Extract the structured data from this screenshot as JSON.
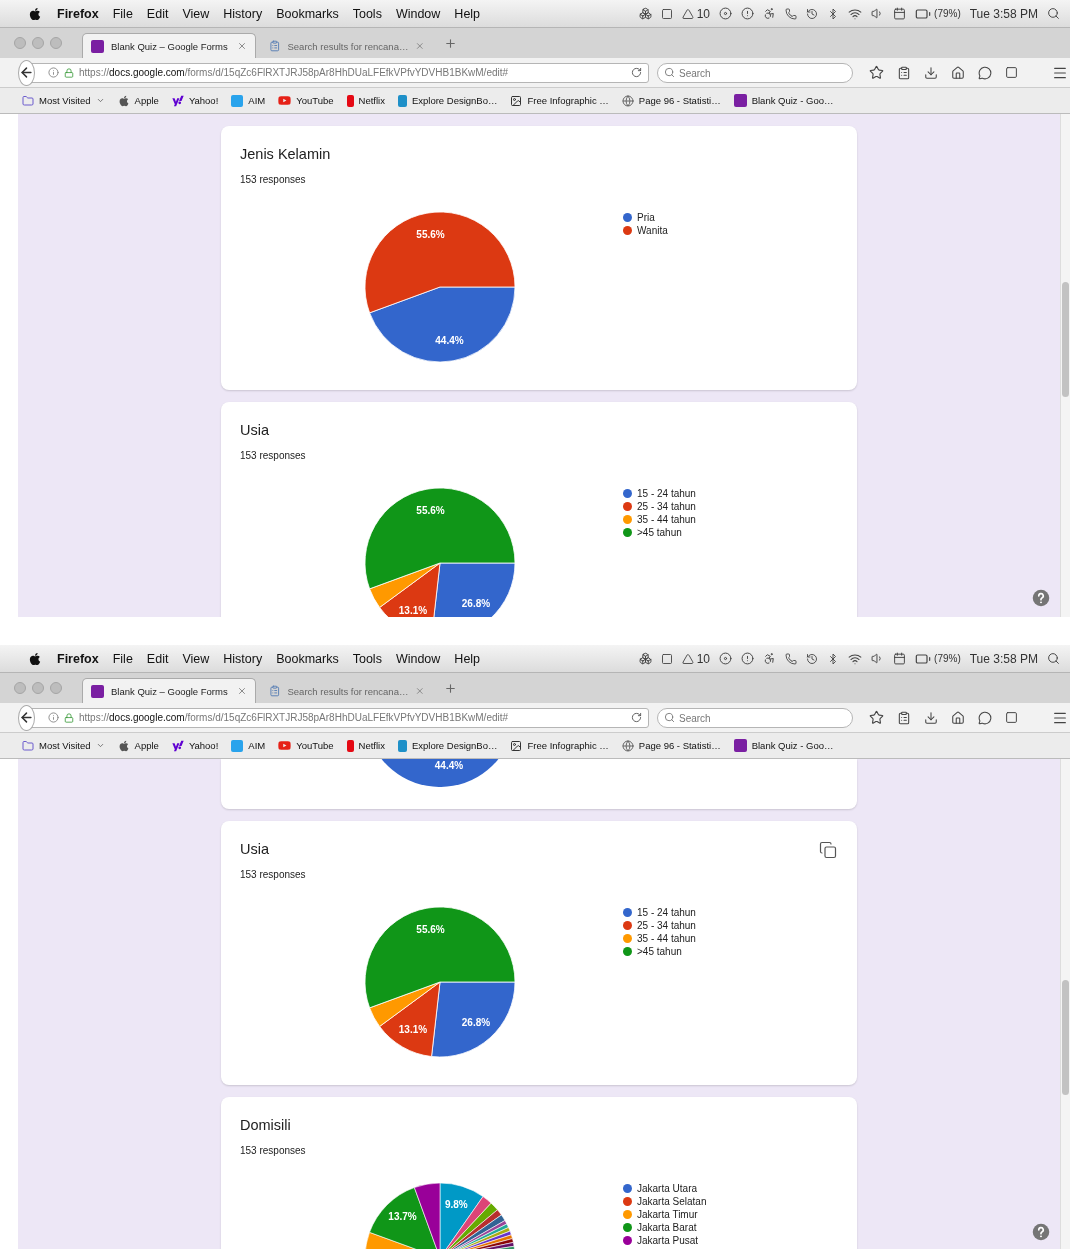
{
  "screens": [
    {
      "menubar": {
        "app": "Firefox",
        "menus": [
          "File",
          "Edit",
          "View",
          "History",
          "Bookmarks",
          "Tools",
          "Window",
          "Help"
        ],
        "status_count": "10",
        "battery": "(79%)",
        "clock": "Tue 3:58 PM"
      },
      "tabs": [
        {
          "label": "Blank Quiz – Google Forms",
          "selected": true
        },
        {
          "label": "Search results for rencana…",
          "selected": false
        }
      ],
      "url": "https://**docs.google.com**/forms/d/15qZc6FlRXTJRJ58pAr8HhDUaLFEfkVPfvYDVHB1BKwM/edit#",
      "search": {
        "placeholder": "Search"
      },
      "bookmarks": [
        "Most Visited",
        "Apple",
        "Yahoo!",
        "AIM",
        "YouTube",
        "Netflix",
        "Explore DesignBo…",
        "Free Infographic …",
        "Page 96 - Statisti…",
        "Blank Quiz - Goo…"
      ],
      "cards": [
        {
          "kind": "chart",
          "title": "Jenis Kelamin",
          "responses": "153 responses",
          "copy_icon": false,
          "chart_data": {
            "type": "pie",
            "categories": [
              "Pria",
              "Wanita"
            ],
            "values": [
              44.4,
              55.6
            ],
            "colors": [
              "#3366cc",
              "#dc3912"
            ],
            "value_labels": [
              "44.4%",
              "55.6%"
            ]
          }
        },
        {
          "kind": "chart",
          "title": "Usia",
          "responses": "153 responses",
          "copy_icon": false,
          "chart_data": {
            "type": "pie",
            "categories": [
              "15 - 24 tahun",
              "25 - 34 tahun",
              "35 - 44 tahun",
              ">45 tahun"
            ],
            "values": [
              26.8,
              13.1,
              4.5,
              55.6
            ],
            "colors": [
              "#3366cc",
              "#dc3912",
              "#ff9900",
              "#109618"
            ],
            "value_labels": [
              "26.8%",
              "13.1%",
              null,
              "55.6%"
            ]
          }
        }
      ]
    },
    {
      "menubar": {
        "app": "Firefox",
        "menus": [
          "File",
          "Edit",
          "View",
          "History",
          "Bookmarks",
          "Tools",
          "Window",
          "Help"
        ],
        "status_count": "10",
        "battery": "(79%)",
        "clock": "Tue 3:58 PM"
      },
      "tabs": [
        {
          "label": "Blank Quiz – Google Forms",
          "selected": true
        },
        {
          "label": "Search results for rencana…",
          "selected": false
        }
      ],
      "url": "https://**docs.google.com**/forms/d/15qZc6FlRXTJRJ58pAr8HhDUaLFEfkVPfvYDVHB1BKwM/edit#",
      "search": {
        "placeholder": "Search"
      },
      "bookmarks": [
        "Most Visited",
        "Apple",
        "Yahoo!",
        "AIM",
        "YouTube",
        "Netflix",
        "Explore DesignBo…",
        "Free Infographic …",
        "Page 96 - Statisti…",
        "Blank Quiz - Goo…"
      ],
      "cards": [
        {
          "kind": "pie_bottom",
          "slice_label": "44.4%"
        },
        {
          "kind": "chart",
          "title": "Usia",
          "responses": "153 responses",
          "copy_icon": true,
          "chart_data": {
            "type": "pie",
            "categories": [
              "15 - 24 tahun",
              "25 - 34 tahun",
              "35 - 44 tahun",
              ">45 tahun"
            ],
            "values": [
              26.8,
              13.1,
              4.5,
              55.6
            ],
            "colors": [
              "#3366cc",
              "#dc3912",
              "#ff9900",
              "#109618"
            ],
            "value_labels": [
              "26.8%",
              "13.1%",
              null,
              "55.6%"
            ]
          }
        },
        {
          "kind": "pie_picture",
          "title": "Domisili",
          "responses": "153 responses",
          "slice_labels": [
            "9.8%",
            "13.7%"
          ],
          "legend": [
            {
              "label": "Jakarta Utara",
              "color": "#3366cc"
            },
            {
              "label": "Jakarta Selatan",
              "color": "#dc3912"
            },
            {
              "label": "Jakarta Timur",
              "color": "#ff9900"
            },
            {
              "label": "Jakarta Barat",
              "color": "#109618"
            },
            {
              "label": "Jakarta Pusat",
              "color": "#990099"
            }
          ]
        }
      ]
    }
  ]
}
